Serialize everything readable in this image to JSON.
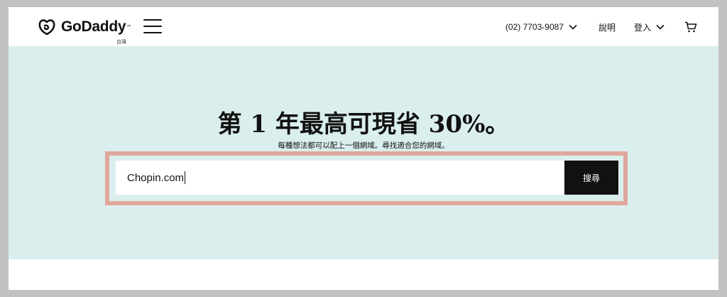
{
  "header": {
    "logo_text": "GoDaddy",
    "logo_trademark": "™",
    "region": "台灣",
    "menu_icon": "hamburger-menu-icon",
    "phone": "(02) 7703-9087",
    "help": "說明",
    "login": "登入",
    "cart_icon": "shopping-cart-icon"
  },
  "hero": {
    "title": "第 1 年最高可現省 30%。",
    "subtitle": "每種想法都可以配上一個網域。尋找適合您的網域。",
    "search_value": "Chopin.com",
    "search_button": "搜尋"
  },
  "colors": {
    "hero_background": "#dbeeee",
    "highlight_border": "#e0a89a",
    "button_background": "#111111",
    "page_frame": "#c2c2c2"
  }
}
